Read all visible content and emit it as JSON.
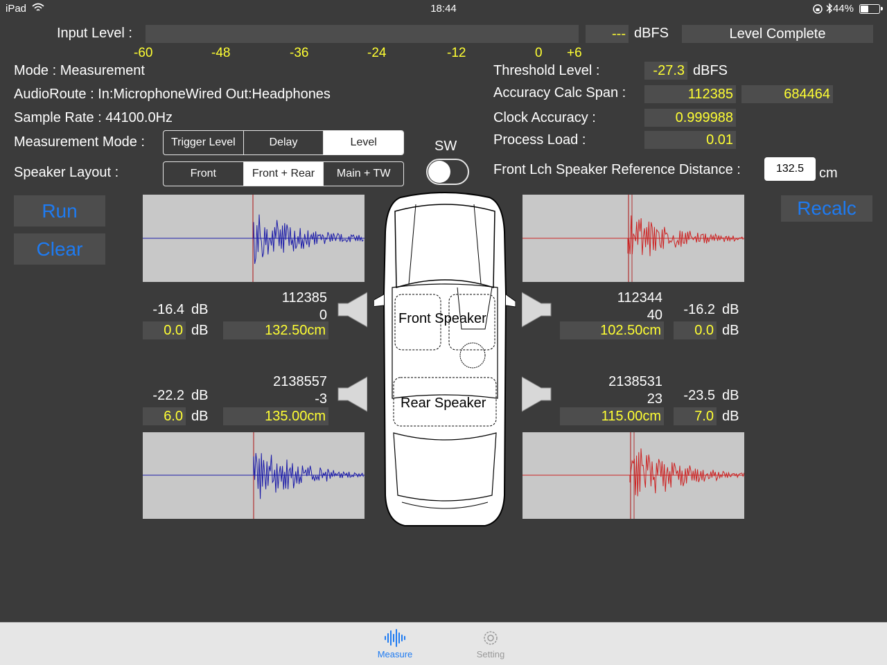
{
  "status": {
    "device": "iPad",
    "time": "18:44",
    "battery": "44%",
    "battery_level": 0.44
  },
  "input": {
    "label": "Input Level :",
    "value": "---",
    "unit": "dBFS",
    "status": "Level Complete",
    "ticks": [
      "-60",
      "-48",
      "-36",
      "-24",
      "-12",
      "0",
      "+6"
    ]
  },
  "info": {
    "mode": "Mode : Measurement",
    "route": "AudioRoute : In:MicrophoneWired Out:Headphones",
    "rate": "Sample Rate : 44100.0Hz",
    "measurement_mode_label": "Measurement Mode :",
    "speaker_layout_label": "Speaker Layout :"
  },
  "measurement_modes": [
    {
      "label": "Trigger Level",
      "selected": false
    },
    {
      "label": "Delay",
      "selected": false
    },
    {
      "label": "Level",
      "selected": true
    }
  ],
  "speaker_layouts": [
    {
      "label": "Front",
      "selected": false
    },
    {
      "label": "Front + Rear",
      "selected": true
    },
    {
      "label": "Main + TW",
      "selected": false
    }
  ],
  "sw": {
    "label": "SW",
    "on": false
  },
  "right": {
    "threshold_label": "Threshold Level :",
    "threshold": "-27.3",
    "threshold_unit": "dBFS",
    "span_label": "Accuracy Calc Span :",
    "span_a": "112385",
    "span_b": "684464",
    "clock_label": "Clock Accuracy :",
    "clock": "0.999988",
    "load_label": "Process Load :",
    "load": "0.01",
    "ref_label": "Front Lch Speaker Reference Distance :",
    "ref": "132.5",
    "ref_unit": "cm"
  },
  "buttons": {
    "run": "Run",
    "clear": "Clear",
    "recalc": "Recalc"
  },
  "speakers": {
    "fl": {
      "count": "112385",
      "delay": "0",
      "level": "-16.4",
      "gain": "0.0",
      "distance": "132.50cm",
      "unit": "dB"
    },
    "fr": {
      "count": "112344",
      "delay": "40",
      "level": "-16.2",
      "gain": "0.0",
      "distance": "102.50cm",
      "unit": "dB"
    },
    "rl": {
      "count": "2138557",
      "delay": "-3",
      "level": "-22.2",
      "gain": "6.0",
      "distance": "135.00cm",
      "unit": "dB"
    },
    "rr": {
      "count": "2138531",
      "delay": "23",
      "level": "-23.5",
      "gain": "7.0",
      "distance": "115.00cm",
      "unit": "dB"
    }
  },
  "car": {
    "front": "Front Speaker",
    "rear": "Rear Speaker"
  },
  "tabs": {
    "measure": "Measure",
    "setting": "Setting"
  },
  "colors": {
    "accent": "#1e7bf2",
    "value": "#ffff33",
    "left_wave": "#1a1aa8",
    "right_wave": "#cc2222",
    "marker": "#b03030"
  }
}
